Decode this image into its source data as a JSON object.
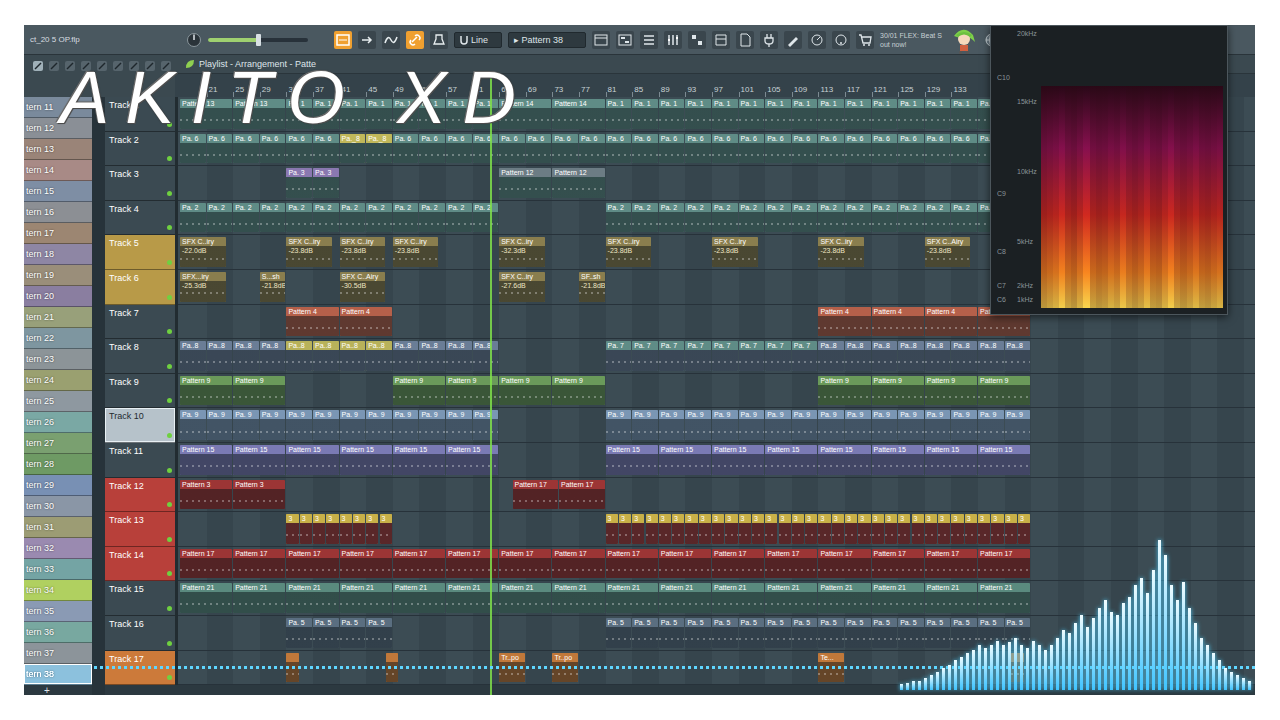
{
  "project": {
    "file": "ct_20 5 OP.flp"
  },
  "toolbar": {
    "master_volume": {
      "level": 0.5
    },
    "tools": [
      {
        "on": true
      },
      {
        "on": false
      },
      {
        "on": false
      },
      {
        "on": true
      },
      {
        "on": false
      }
    ],
    "snap": "Line",
    "pattern_arrow": "▸",
    "pattern": "Pattern 38",
    "news": [
      "30/01 FLEX: Beat S",
      "out now!"
    ]
  },
  "playlist": {
    "title": "Playlist - Arrangement - Patte",
    "ruler": [
      {
        "label": "21",
        "bar": 21
      },
      {
        "label": "25",
        "bar": 25
      },
      {
        "label": "29",
        "bar": 29
      },
      {
        "label": "33",
        "bar": 33
      },
      {
        "label": "37",
        "bar": 37
      },
      {
        "label": "41",
        "bar": 41
      },
      {
        "label": "45",
        "bar": 45
      },
      {
        "label": "49",
        "bar": 49
      },
      {
        "label": "53",
        "bar": 53
      },
      {
        "label": "57",
        "bar": 57
      },
      {
        "label": "61",
        "bar": 61
      },
      {
        "label": "65",
        "bar": 65
      },
      {
        "label": "69",
        "bar": 69
      },
      {
        "label": "73",
        "bar": 73
      },
      {
        "label": "77",
        "bar": 77
      },
      {
        "label": "81",
        "bar": 81
      },
      {
        "label": "85",
        "bar": 85
      },
      {
        "label": "89",
        "bar": 89
      },
      {
        "label": "93",
        "bar": 93
      },
      {
        "label": "97",
        "bar": 97
      },
      {
        "label": "101",
        "bar": 101
      },
      {
        "label": "105",
        "bar": 105
      },
      {
        "label": "109",
        "bar": 109
      },
      {
        "label": "113",
        "bar": 113
      },
      {
        "label": "117",
        "bar": 117
      },
      {
        "label": "121",
        "bar": 121
      },
      {
        "label": "125",
        "bar": 125
      },
      {
        "label": "129",
        "bar": 129
      },
      {
        "label": "133",
        "bar": 133
      }
    ],
    "playhead": {
      "bar": 63.6
    },
    "tracks": [
      {
        "name": "Track 1",
        "color": "#3b4a52",
        "selected": false,
        "enabled": true,
        "clip_color": "#5f8c86",
        "clips": [
          {
            "label": "Pattern 13",
            "start": 17,
            "length": 8,
            "count": 2
          },
          {
            "label": "Pa. 1",
            "start": 33,
            "length": 4,
            "count": 8
          },
          {
            "label": "Pattern 14",
            "start": 65,
            "length": 8,
            "count": 2
          },
          {
            "label": "Pa. 1",
            "start": 81,
            "length": 4,
            "count": 16
          }
        ]
      },
      {
        "name": "Track 2",
        "color": "#3b4a52",
        "selected": false,
        "enabled": true,
        "clip_color": "#5f8c86",
        "clips": [
          {
            "label": "Pa. 6",
            "start": 17,
            "length": 4,
            "count": 6
          },
          {
            "label": "Pa._8",
            "start": 41,
            "length": 4,
            "count": 2,
            "color": "#c0b85a"
          },
          {
            "label": "Pa. 6",
            "start": 49,
            "length": 4,
            "count": 24
          }
        ]
      },
      {
        "name": "Track 3",
        "color": "#3b4a52",
        "selected": false,
        "enabled": true,
        "clip_color": "#5f8c86",
        "clips": [
          {
            "label": "Pa. 3",
            "start": 33,
            "length": 4,
            "count": 2,
            "color": "#8a78b0"
          },
          {
            "label": "Pattern 12",
            "start": 65,
            "length": 8,
            "count": 2,
            "color": "#6c7c84"
          }
        ]
      },
      {
        "name": "Track 4",
        "color": "#3b4a52",
        "selected": false,
        "enabled": true,
        "clip_color": "#5f8c86",
        "clips": [
          {
            "label": "Pa. 2",
            "start": 17,
            "length": 4,
            "count": 12
          },
          {
            "label": "Pa. 2",
            "start": 81,
            "length": 4,
            "count": 16
          }
        ]
      },
      {
        "name": "Track 5",
        "color": "#b89a48",
        "selected": false,
        "enabled": true,
        "clip_color": "#8a7e4e",
        "clips": [
          {
            "label": "SFX C..iry",
            "detail": "-22.0dB",
            "start": 17,
            "length": 7,
            "count": 1
          },
          {
            "label": "SFX C..iry",
            "detail": "-23.8dB",
            "start": 33,
            "length": 7,
            "count": 1
          },
          {
            "label": "SFX C..iry",
            "detail": "-23.8dB",
            "start": 41,
            "length": 7,
            "count": 1
          },
          {
            "label": "SFX C..iry",
            "detail": "-23.8dB",
            "start": 49,
            "length": 7,
            "count": 1
          },
          {
            "label": "SFX C..iry",
            "detail": "-32.3dB",
            "start": 65,
            "length": 7,
            "count": 1
          },
          {
            "label": "SFX C..iry",
            "detail": "-23.8dB",
            "start": 81,
            "length": 7,
            "count": 1
          },
          {
            "label": "SFX C..iry",
            "detail": "-23.8dB",
            "start": 97,
            "length": 7,
            "count": 1
          },
          {
            "label": "SFX C..iry",
            "detail": "-23.8dB",
            "start": 113,
            "length": 7,
            "count": 1
          },
          {
            "label": "SFX C..Airy",
            "detail": "-23.8dB",
            "start": 129,
            "length": 7,
            "count": 1
          }
        ]
      },
      {
        "name": "Track 6",
        "color": "#b89a48",
        "selected": false,
        "enabled": true,
        "clip_color": "#8a7e4e",
        "clips": [
          {
            "label": "SFX...iry",
            "detail": "-25.3dB",
            "start": 17,
            "length": 7,
            "count": 1
          },
          {
            "label": "S...sh",
            "detail": "-21.8dB",
            "start": 29,
            "length": 4,
            "count": 1
          },
          {
            "label": "SFX C..Airy",
            "detail": "-30.5dB",
            "start": 41,
            "length": 7,
            "count": 1
          },
          {
            "label": "SFX C..iry",
            "detail": "-27.6dB",
            "start": 65,
            "length": 7,
            "count": 1
          },
          {
            "label": "SF..sh",
            "detail": "-21.8dB",
            "start": 77,
            "length": 4,
            "count": 1
          }
        ]
      },
      {
        "name": "Track 7",
        "color": "#3b4a52",
        "selected": false,
        "enabled": true,
        "clip_color": "#b5604a",
        "clips": [
          {
            "label": "Pattern 4",
            "start": 33,
            "length": 8,
            "count": 2
          },
          {
            "label": "Pattern 4",
            "start": 113,
            "length": 8,
            "count": 4
          }
        ]
      },
      {
        "name": "Track 8",
        "color": "#3b4a52",
        "selected": false,
        "enabled": true,
        "clip_color": "#6a7d96",
        "clips": [
          {
            "label": "Pa..8",
            "start": 17,
            "length": 4,
            "count": 4
          },
          {
            "label": "Pa..8",
            "start": 33,
            "length": 4,
            "count": 4,
            "color": "#b8b25a"
          },
          {
            "label": "Pa..8",
            "start": 49,
            "length": 4,
            "count": 4
          },
          {
            "label": "Pa. 7",
            "start": 81,
            "length": 4,
            "count": 8,
            "color": "#5f8c86"
          },
          {
            "label": "Pa..8",
            "start": 113,
            "length": 4,
            "count": 8
          }
        ]
      },
      {
        "name": "Track 9",
        "color": "#3b4a52",
        "selected": false,
        "enabled": true,
        "clip_color": "#6a9a5a",
        "clips": [
          {
            "label": "Pattern 9",
            "start": 17,
            "length": 8,
            "count": 2
          },
          {
            "label": "Pattern 9",
            "start": 49,
            "length": 8,
            "count": 4
          },
          {
            "label": "Pattern 9",
            "start": 113,
            "length": 8,
            "count": 4
          }
        ]
      },
      {
        "name": "Track 10",
        "color": "#b6c2ca",
        "selected": true,
        "enabled": true,
        "clip_color": "#7a96b4",
        "clips": [
          {
            "label": "Pa. 9",
            "start": 17,
            "length": 4,
            "count": 8
          },
          {
            "label": "Pa. 9",
            "start": 49,
            "length": 4,
            "count": 4
          },
          {
            "label": "Pa. 9",
            "start": 81,
            "length": 4,
            "count": 16
          }
        ]
      },
      {
        "name": "Track 11",
        "color": "#3b4a52",
        "selected": false,
        "enabled": true,
        "clip_color": "#7a7ab4",
        "clips": [
          {
            "label": "Pattern 15",
            "start": 17,
            "length": 8,
            "count": 6
          },
          {
            "label": "Pattern 15",
            "start": 81,
            "length": 8,
            "count": 8
          }
        ]
      },
      {
        "name": "Track 12",
        "color": "#b8403a",
        "selected": false,
        "enabled": true,
        "clip_color": "#9c3535",
        "clips": [
          {
            "label": "Pattern 3",
            "start": 17,
            "length": 8,
            "count": 2
          },
          {
            "label": "Pattern 17",
            "start": 67,
            "length": 7,
            "count": 2
          }
        ]
      },
      {
        "name": "Track 13",
        "color": "#b8403a",
        "selected": false,
        "enabled": true,
        "clip_color": "#a83c3c",
        "clips": [
          {
            "label": "3",
            "start": 33,
            "length": 2,
            "count": 8,
            "color": "#c8b048"
          },
          {
            "label": "3",
            "start": 81,
            "length": 2,
            "count": 32,
            "color": "#c8b048"
          }
        ]
      },
      {
        "name": "Track 14",
        "color": "#b8403a",
        "selected": false,
        "enabled": true,
        "clip_color": "#9c3535",
        "clips": [
          {
            "label": "Pattern 17",
            "start": 17,
            "length": 8,
            "count": 16
          }
        ]
      },
      {
        "name": "Track 15",
        "color": "#3b4a52",
        "selected": false,
        "enabled": true,
        "clip_color": "#5a8a7e",
        "clips": [
          {
            "label": "Pattern 21",
            "start": 17,
            "length": 8,
            "count": 16
          }
        ]
      },
      {
        "name": "Track 16",
        "color": "#3b4a52",
        "selected": false,
        "enabled": true,
        "clip_color": "#5a6e80",
        "clips": [
          {
            "label": "Pa. 5",
            "start": 33,
            "length": 4,
            "count": 4
          },
          {
            "label": "Pa. 5",
            "start": 81,
            "length": 4,
            "count": 16
          }
        ]
      },
      {
        "name": "Track 17",
        "color": "#cc7a3a",
        "selected": false,
        "enabled": true,
        "clip_color": "#c0783a",
        "clips": [
          {
            "start": 33,
            "length": 2,
            "count": 1
          },
          {
            "start": 48,
            "length": 2,
            "count": 1
          },
          {
            "label": "Tr..po",
            "start": 65,
            "length": 4,
            "count": 1
          },
          {
            "label": "Tr..po",
            "start": 73,
            "length": 4,
            "count": 1
          },
          {
            "label": "Te...",
            "start": 113,
            "length": 4,
            "count": 1
          },
          {
            "start": 142,
            "length": 2,
            "count": 1
          }
        ]
      }
    ]
  },
  "patterns": {
    "items": [
      {
        "label": "tern 11",
        "color": "#7a8a9c",
        "selected": false
      },
      {
        "label": "tern 12",
        "color": "#8a8f96",
        "selected": false
      },
      {
        "label": "tern 13",
        "color": "#9a8478",
        "selected": false
      },
      {
        "label": "tern 14",
        "color": "#a88a86",
        "selected": false
      },
      {
        "label": "tern 15",
        "color": "#7e8ea4",
        "selected": false
      },
      {
        "label": "tern 16",
        "color": "#8c8f94",
        "selected": false
      },
      {
        "label": "tern 17",
        "color": "#9c8672",
        "selected": false
      },
      {
        "label": "tern 18",
        "color": "#8e86a4",
        "selected": false
      },
      {
        "label": "tern 19",
        "color": "#9a8e7a",
        "selected": false
      },
      {
        "label": "tern 20",
        "color": "#8a7ea0",
        "selected": false
      },
      {
        "label": "tern 21",
        "color": "#98a07a",
        "selected": false
      },
      {
        "label": "tern 22",
        "color": "#7e96a0",
        "selected": false
      },
      {
        "label": "tern 23",
        "color": "#8c9498",
        "selected": false
      },
      {
        "label": "tern 24",
        "color": "#9aa070",
        "selected": false
      },
      {
        "label": "tern 25",
        "color": "#8e98a0",
        "selected": false
      },
      {
        "label": "tern 26",
        "color": "#7aa8a4",
        "selected": false
      },
      {
        "label": "tern 27",
        "color": "#7aa070",
        "selected": false
      },
      {
        "label": "tern 28",
        "color": "#6e9a64",
        "selected": false
      },
      {
        "label": "tern 29",
        "color": "#7890b4",
        "selected": false
      },
      {
        "label": "tern 30",
        "color": "#8a96a6",
        "selected": false
      },
      {
        "label": "tern 31",
        "color": "#9c9c74",
        "selected": false
      },
      {
        "label": "tern 32",
        "color": "#9a8ab0",
        "selected": false
      },
      {
        "label": "tern 33",
        "color": "#74a4a4",
        "selected": false
      },
      {
        "label": "tern 34",
        "color": "#b0d060",
        "selected": false
      },
      {
        "label": "tern 35",
        "color": "#8a9ab4",
        "selected": false
      },
      {
        "label": "tern 36",
        "color": "#78a8a0",
        "selected": false
      },
      {
        "label": "tern 37",
        "color": "#8c949a",
        "selected": false
      },
      {
        "label": "tern 38",
        "color": "#7aa8c0",
        "selected": true
      }
    ],
    "add": "+"
  },
  "watermark": "AKITO XD",
  "spectrogram": {
    "freq_labels": [
      "20kHz",
      "15kHz",
      "10kHz",
      "5kHz",
      "2kHz",
      "1kHz"
    ],
    "note_labels": [
      "C10",
      "C9",
      "C8",
      "C7",
      "C6"
    ],
    "columns": [
      0.5,
      0.6,
      0.7,
      0.9,
      0.6,
      0.5,
      0.7,
      0.95,
      0.6,
      0.5,
      0.55,
      0.7,
      0.6,
      0.85,
      0.6,
      0.5,
      0.6,
      0.8,
      0.55,
      0.5,
      0.7,
      0.9,
      0.6,
      0.5,
      0.6,
      0.75,
      0.55,
      0.5,
      0.6,
      0.7
    ]
  },
  "visualizer": {
    "levels": [
      0.04,
      0.05,
      0.06,
      0.06,
      0.08,
      0.1,
      0.12,
      0.15,
      0.17,
      0.2,
      0.22,
      0.25,
      0.27,
      0.3,
      0.28,
      0.3,
      0.33,
      0.3,
      0.32,
      0.35,
      0.3,
      0.28,
      0.33,
      0.3,
      0.27,
      0.3,
      0.35,
      0.4,
      0.38,
      0.45,
      0.5,
      0.42,
      0.48,
      0.55,
      0.6,
      0.52,
      0.5,
      0.58,
      0.62,
      0.7,
      0.75,
      0.65,
      0.8,
      1.0,
      0.9,
      0.7,
      0.6,
      0.72,
      0.55,
      0.45,
      0.35,
      0.3,
      0.25,
      0.2,
      0.15,
      0.12,
      0.1,
      0.08,
      0.06
    ]
  }
}
